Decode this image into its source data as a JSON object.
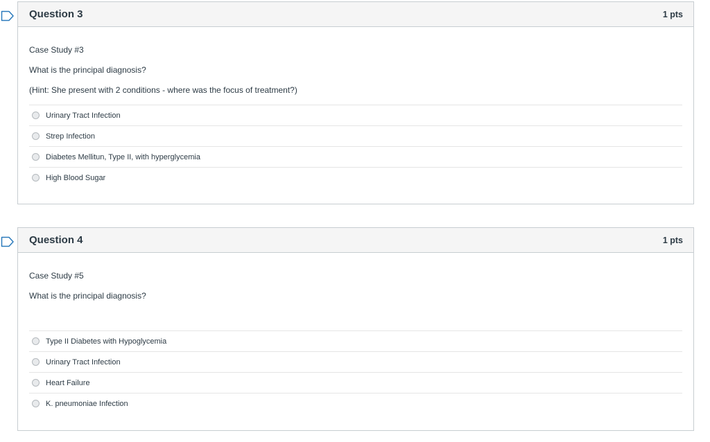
{
  "colors": {
    "flag_outline": "#2b7abc",
    "header_bg": "#f5f5f5",
    "border": "#c7cdd1",
    "text": "#2d3b45"
  },
  "questions": [
    {
      "title": "Question 3",
      "points": "1 pts",
      "flag_icon": "bookmark-flag-icon",
      "text": [
        "Case Study #3",
        "What is the principal diagnosis?",
        "(Hint: She present with 2 conditions - where was the focus of treatment?)"
      ],
      "answers": [
        "Urinary Tract Infection",
        "Strep Infection",
        "Diabetes Mellitun, Type II, with hyperglycemia",
        "High Blood Sugar"
      ]
    },
    {
      "title": "Question 4",
      "points": "1 pts",
      "flag_icon": "bookmark-flag-icon",
      "text": [
        "Case Study #5",
        "What is the principal diagnosis?"
      ],
      "answers": [
        "Type II Diabetes with Hypoglycemia",
        "Urinary Tract Infection",
        "Heart Failure",
        "K. pneumoniae Infection"
      ]
    }
  ]
}
